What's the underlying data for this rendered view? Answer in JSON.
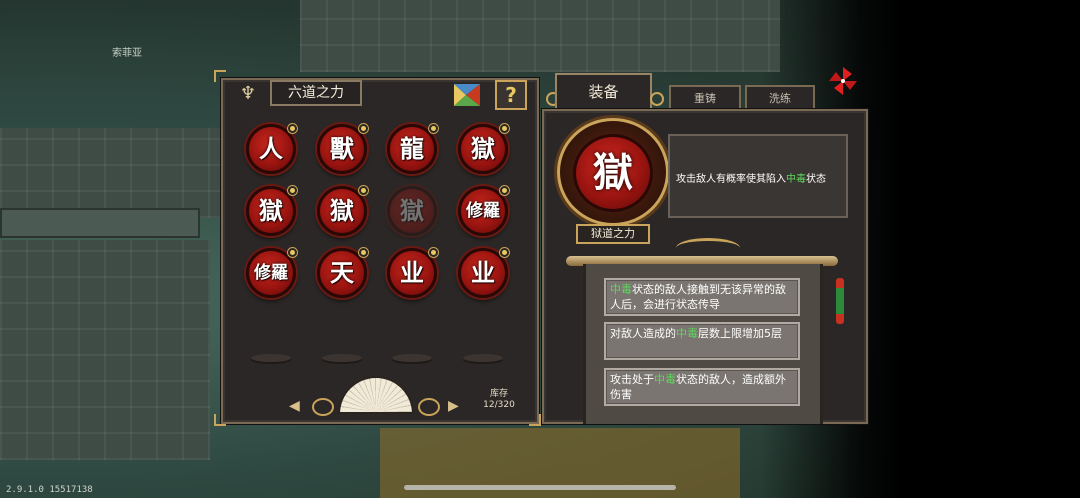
{
  "background": {
    "character_name": "索菲亚",
    "version_text": "2.9.1.0 15517138"
  },
  "left_panel": {
    "title": "六道之力",
    "help_label": "?",
    "runes": [
      {
        "glyph": "人",
        "dim": false
      },
      {
        "glyph": "獸",
        "dim": false
      },
      {
        "glyph": "龍",
        "dim": false
      },
      {
        "glyph": "獄",
        "dim": false
      },
      {
        "glyph": "獄",
        "dim": false
      },
      {
        "glyph": "獄",
        "dim": false
      },
      {
        "glyph": "獄",
        "dim": true
      },
      {
        "glyph": "修羅",
        "dim": false
      },
      {
        "glyph": "修羅",
        "dim": false
      },
      {
        "glyph": "天",
        "dim": false
      },
      {
        "glyph": "业",
        "dim": false
      },
      {
        "glyph": "业",
        "dim": false
      }
    ],
    "pager_prev": "◀",
    "pager_next": "▶",
    "stock_label": "库存",
    "stock_value": "12/320"
  },
  "tabs": {
    "equip": "装备",
    "recast": "重铸",
    "refine": "洗练"
  },
  "right_panel": {
    "equipped_glyph": "獄",
    "equipped_name": "狱道之力",
    "description_prefix": "攻击敌人有概率使其陷入",
    "description_keyword": "中毒",
    "description_suffix": "状态",
    "effects": [
      {
        "keyword": "中毒",
        "text_before": "",
        "text_after": "状态的敌人接触到无该异常的敌人后，会进行状态传导"
      },
      {
        "keyword": "中毒",
        "text_before": "对敌人造成的",
        "text_after": "层数上限增加5层"
      },
      {
        "keyword": "中毒",
        "text_before": "攻击处于",
        "text_after": "状态的敌人，造成额外伤害"
      }
    ]
  },
  "colors": {
    "rune_red": "#9a1410",
    "gold_trim": "#c9a45a",
    "keyword_green": "#5cd85c",
    "panel_bg": "#2a2726"
  }
}
